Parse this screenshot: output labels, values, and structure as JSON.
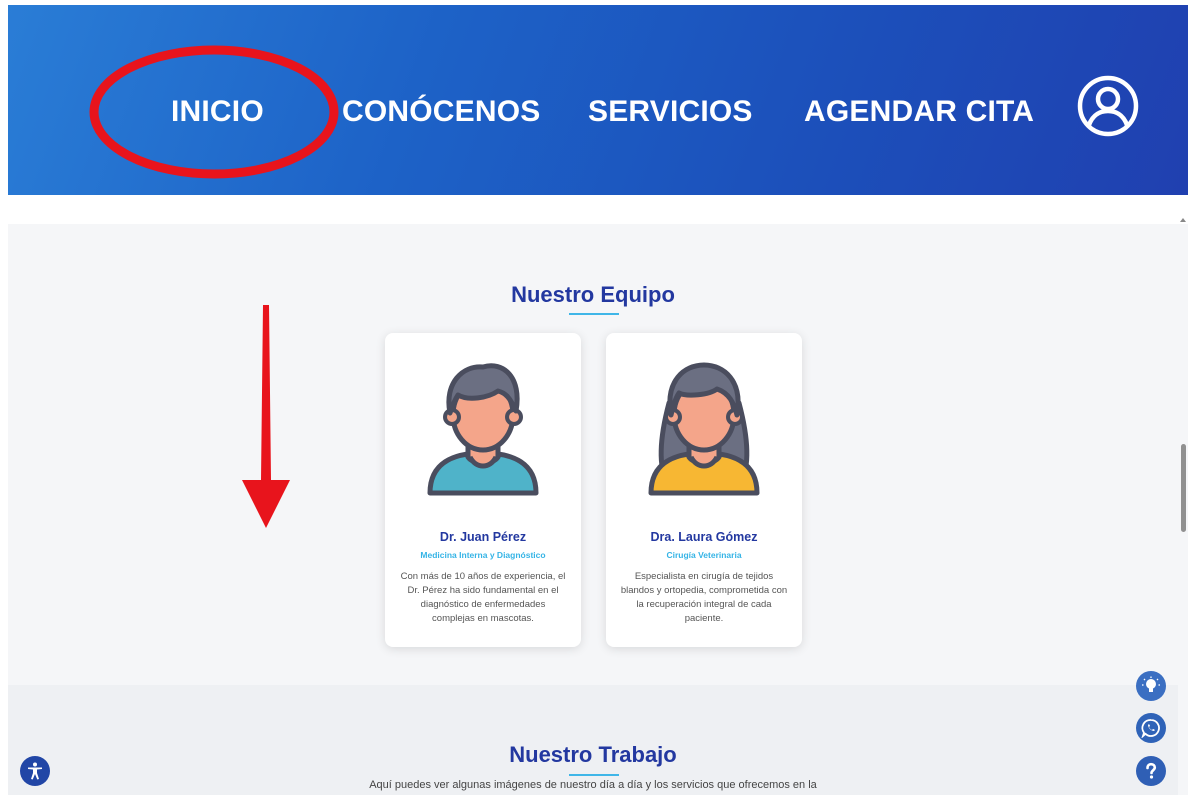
{
  "nav": {
    "items": [
      {
        "label": "INICIO"
      },
      {
        "label": "CONÓCENOS"
      },
      {
        "label": "SERVICIOS"
      },
      {
        "label": "AGENDAR CITA"
      }
    ],
    "user_icon": "user-circle-icon"
  },
  "team": {
    "title": "Nuestro Equipo",
    "members": [
      {
        "name": "Dr. Juan Pérez",
        "role": "Medicina Interna y Diagnóstico",
        "description": "Con más de 10 años de experiencia, el Dr. Pérez ha sido fundamental en el diagnóstico de enfermedades complejas en mascotas.",
        "avatar": "male-doctor-avatar",
        "shirt_color": "#4fb3c9"
      },
      {
        "name": "Dra. Laura Gómez",
        "role": "Cirugía Veterinaria",
        "description": "Especialista en cirugía de tejidos blandos y ortopedia, comprometida con la recuperación integral de cada paciente.",
        "avatar": "female-doctor-avatar",
        "shirt_color": "#f7b733"
      }
    ]
  },
  "work": {
    "title": "Nuestro Trabajo",
    "description": "Aquí puedes ver algunas imágenes de nuestro día a día y los servicios que ofrecemos en la"
  },
  "floating_buttons": [
    "lightbulb-icon",
    "whatsapp-icon",
    "help-icon",
    "accessibility-icon"
  ],
  "colors": {
    "nav_gradient_start": "#2a7dd6",
    "nav_gradient_end": "#2040b0",
    "heading": "#2338a0",
    "accent": "#35b4e6",
    "annotation": "#e8141c"
  }
}
